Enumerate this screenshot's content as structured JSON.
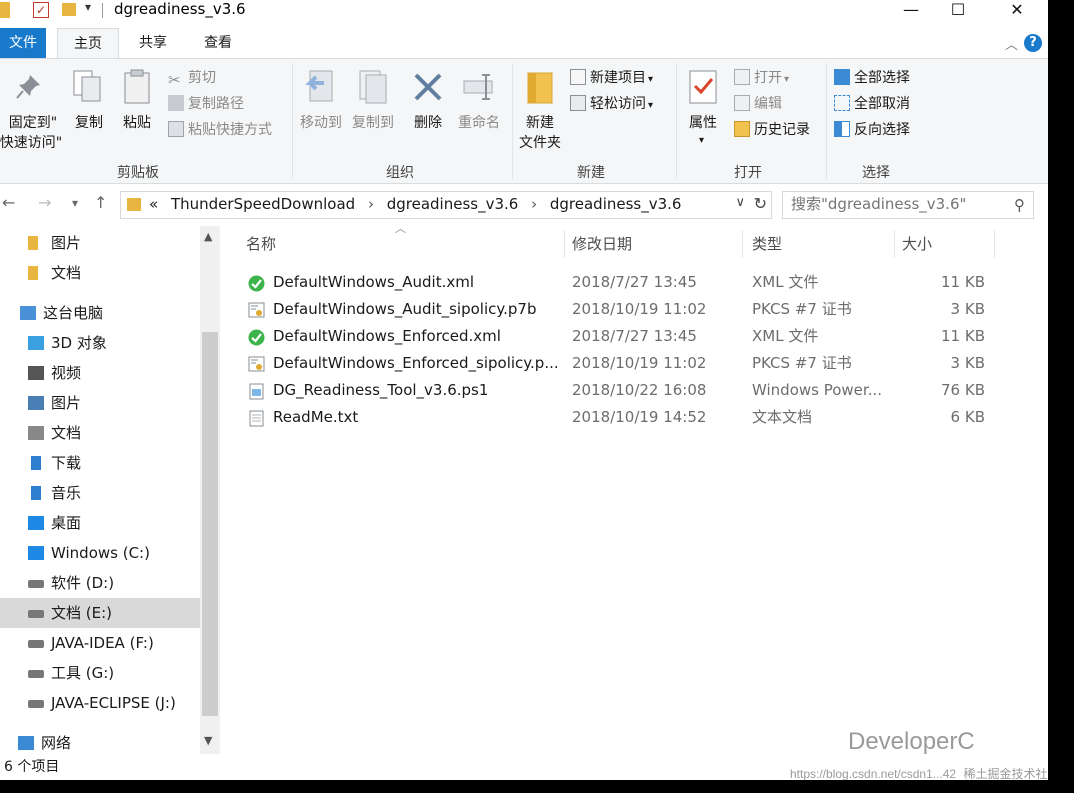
{
  "window": {
    "title": "dgreadiness_v3.6",
    "minimize": "—",
    "maximize": "☐",
    "close": "✕"
  },
  "ribbon_tabs": [
    "文件",
    "主页",
    "共享",
    "查看"
  ],
  "ribbon": {
    "clipboard": {
      "label": "剪贴板",
      "pin": "固定到\"",
      "pin2": "快速访问\"",
      "copy": "复制",
      "paste": "粘贴",
      "cut": "剪切",
      "copy_path": "复制路径",
      "paste_shortcut": "粘贴快捷方式"
    },
    "organize": {
      "label": "组织",
      "move_to": "移动到",
      "copy_to": "复制到",
      "delete": "删除",
      "rename": "重命名"
    },
    "new": {
      "label": "新建",
      "new_folder": "新建",
      "new_folder2": "文件夹",
      "new_item": "新建项目",
      "easy_access": "轻松访问"
    },
    "open": {
      "label": "打开",
      "properties": "属性",
      "open": "打开",
      "edit": "编辑",
      "history": "历史记录"
    },
    "select": {
      "label": "选择",
      "select_all": "全部选择",
      "select_none": "全部取消",
      "invert": "反向选择"
    }
  },
  "address": {
    "overflow": "«",
    "crumbs": [
      "ThunderSpeedDownload",
      "dgreadiness_v3.6",
      "dgreadiness_v3.6"
    ],
    "search_placeholder": "搜索\"dgreadiness_v3.6\""
  },
  "nav_pane": {
    "items": [
      {
        "label": "图片",
        "icon": "folder-icon",
        "color": "#e8b540"
      },
      {
        "label": "文档",
        "icon": "folder-icon",
        "color": "#e8b540"
      },
      {
        "label": "这台电脑",
        "icon": "computer-icon",
        "color": "#4a90d9"
      },
      {
        "label": "3D 对象",
        "icon": "cube-icon",
        "color": "#3ba0e0"
      },
      {
        "label": "视频",
        "icon": "video-icon",
        "color": "#555555"
      },
      {
        "label": "图片",
        "icon": "pictures-icon",
        "color": "#4a7fb5"
      },
      {
        "label": "文档",
        "icon": "documents-icon",
        "color": "#888888"
      },
      {
        "label": "下载",
        "icon": "download-icon",
        "color": "#2f7fd1"
      },
      {
        "label": "音乐",
        "icon": "music-icon",
        "color": "#2f7fd1"
      },
      {
        "label": "桌面",
        "icon": "desktop-icon",
        "color": "#1e88e5"
      },
      {
        "label": "Windows (C:)",
        "icon": "windows-drive-icon",
        "color": "#1e88e5"
      },
      {
        "label": "软件 (D:)",
        "icon": "drive-icon",
        "color": "#777777"
      },
      {
        "label": "文档 (E:)",
        "icon": "drive-icon",
        "color": "#777777"
      },
      {
        "label": "JAVA-IDEA (F:)",
        "icon": "drive-icon",
        "color": "#777777"
      },
      {
        "label": "工具 (G:)",
        "icon": "drive-icon",
        "color": "#777777"
      },
      {
        "label": "JAVA-ECLIPSE (J:)",
        "icon": "drive-icon",
        "color": "#777777"
      },
      {
        "label": "网络",
        "icon": "network-icon",
        "color": "#3a8ad6"
      }
    ]
  },
  "columns": [
    "名称",
    "修改日期",
    "类型",
    "大小"
  ],
  "files": [
    {
      "name": "DefaultWindows_Audit.xml",
      "date": "2018/7/27 13:45",
      "type": "XML 文件",
      "size": "11 KB",
      "icon": "xml-icon"
    },
    {
      "name": "DefaultWindows_Audit_sipolicy.p7b",
      "date": "2018/10/19 11:02",
      "type": "PKCS #7 证书",
      "size": "3 KB",
      "icon": "certificate-icon"
    },
    {
      "name": "DefaultWindows_Enforced.xml",
      "date": "2018/7/27 13:45",
      "type": "XML 文件",
      "size": "11 KB",
      "icon": "xml-icon"
    },
    {
      "name": "DefaultWindows_Enforced_sipolicy.p...",
      "date": "2018/10/19 11:02",
      "type": "PKCS #7 证书",
      "size": "3 KB",
      "icon": "certificate-icon"
    },
    {
      "name": "DG_Readiness_Tool_v3.6.ps1",
      "date": "2018/10/22 16:08",
      "type": "Windows Power...",
      "size": "76 KB",
      "icon": "script-icon"
    },
    {
      "name": "ReadMe.txt",
      "date": "2018/10/19 14:52",
      "type": "文本文档",
      "size": "6 KB",
      "icon": "text-file-icon"
    }
  ],
  "status": "6 个项目",
  "watermark": {
    "brand": "DeveloperC",
    "cn": "稀土掘金技术社区",
    "url": "https://blog.csdn.net/csdn1...42"
  },
  "colors": {
    "accent": "#1979ca",
    "folder": "#e8b540",
    "xml_green": "#3cb44b",
    "selected": "#d9d9d9"
  }
}
